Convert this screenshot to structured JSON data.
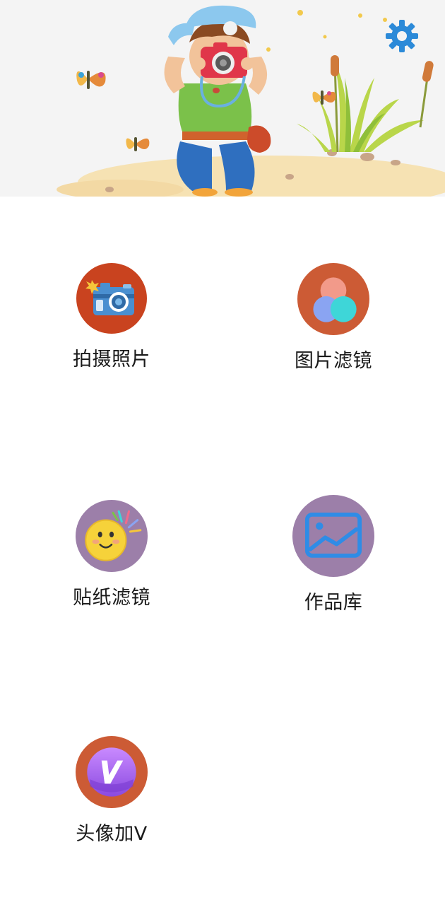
{
  "header": {
    "banner_icon": "boy-with-camera-illustration",
    "settings_icon": "gear-icon",
    "accent_color": "#2c8ad8"
  },
  "features": [
    {
      "key": "take-photo",
      "label": "拍摄照片",
      "icon": "camera-icon",
      "bg": "#c9431f"
    },
    {
      "key": "photo-filter",
      "label": "图片滤镜",
      "icon": "color-circles-icon",
      "bg": "#cc5b35"
    },
    {
      "key": "sticker-filter",
      "label": "贴纸滤镜",
      "icon": "smiley-sticker-icon",
      "bg": "#9c7fa9"
    },
    {
      "key": "gallery",
      "label": "作品库",
      "icon": "picture-frame-icon",
      "bg": "#9c7fa9"
    },
    {
      "key": "avatar-v",
      "label": "头像加V",
      "icon": "v-badge-icon",
      "bg": "#cc5b35"
    }
  ]
}
